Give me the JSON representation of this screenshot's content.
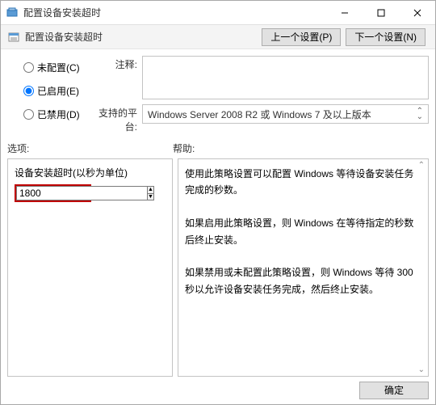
{
  "window": {
    "title": "配置设备安装超时"
  },
  "subheader": {
    "title": "配置设备安装超时"
  },
  "nav": {
    "prev": "上一个设置(P)",
    "next": "下一个设置(N)"
  },
  "radios": {
    "not_configured": "未配置(C)",
    "enabled": "已启用(E)",
    "disabled": "已禁用(D)",
    "selected": "enabled"
  },
  "labels": {
    "comment": "注释:",
    "platform": "支持的平台:",
    "options": "选项:",
    "help": "帮助:"
  },
  "comment_value": "",
  "platform_value": "Windows Server 2008 R2 或 Windows 7 及以上版本",
  "option": {
    "label": "设备安装超时(以秒为单位)",
    "value": "1800"
  },
  "help_text": "使用此策略设置可以配置 Windows 等待设备安装任务完成的秒数。\n\n如果启用此策略设置，则 Windows 在等待指定的秒数后终止安装。\n\n如果禁用或未配置此策略设置，则 Windows 等待 300 秒以允许设备安装任务完成，然后终止安装。",
  "footer": {
    "ok": "确定"
  }
}
